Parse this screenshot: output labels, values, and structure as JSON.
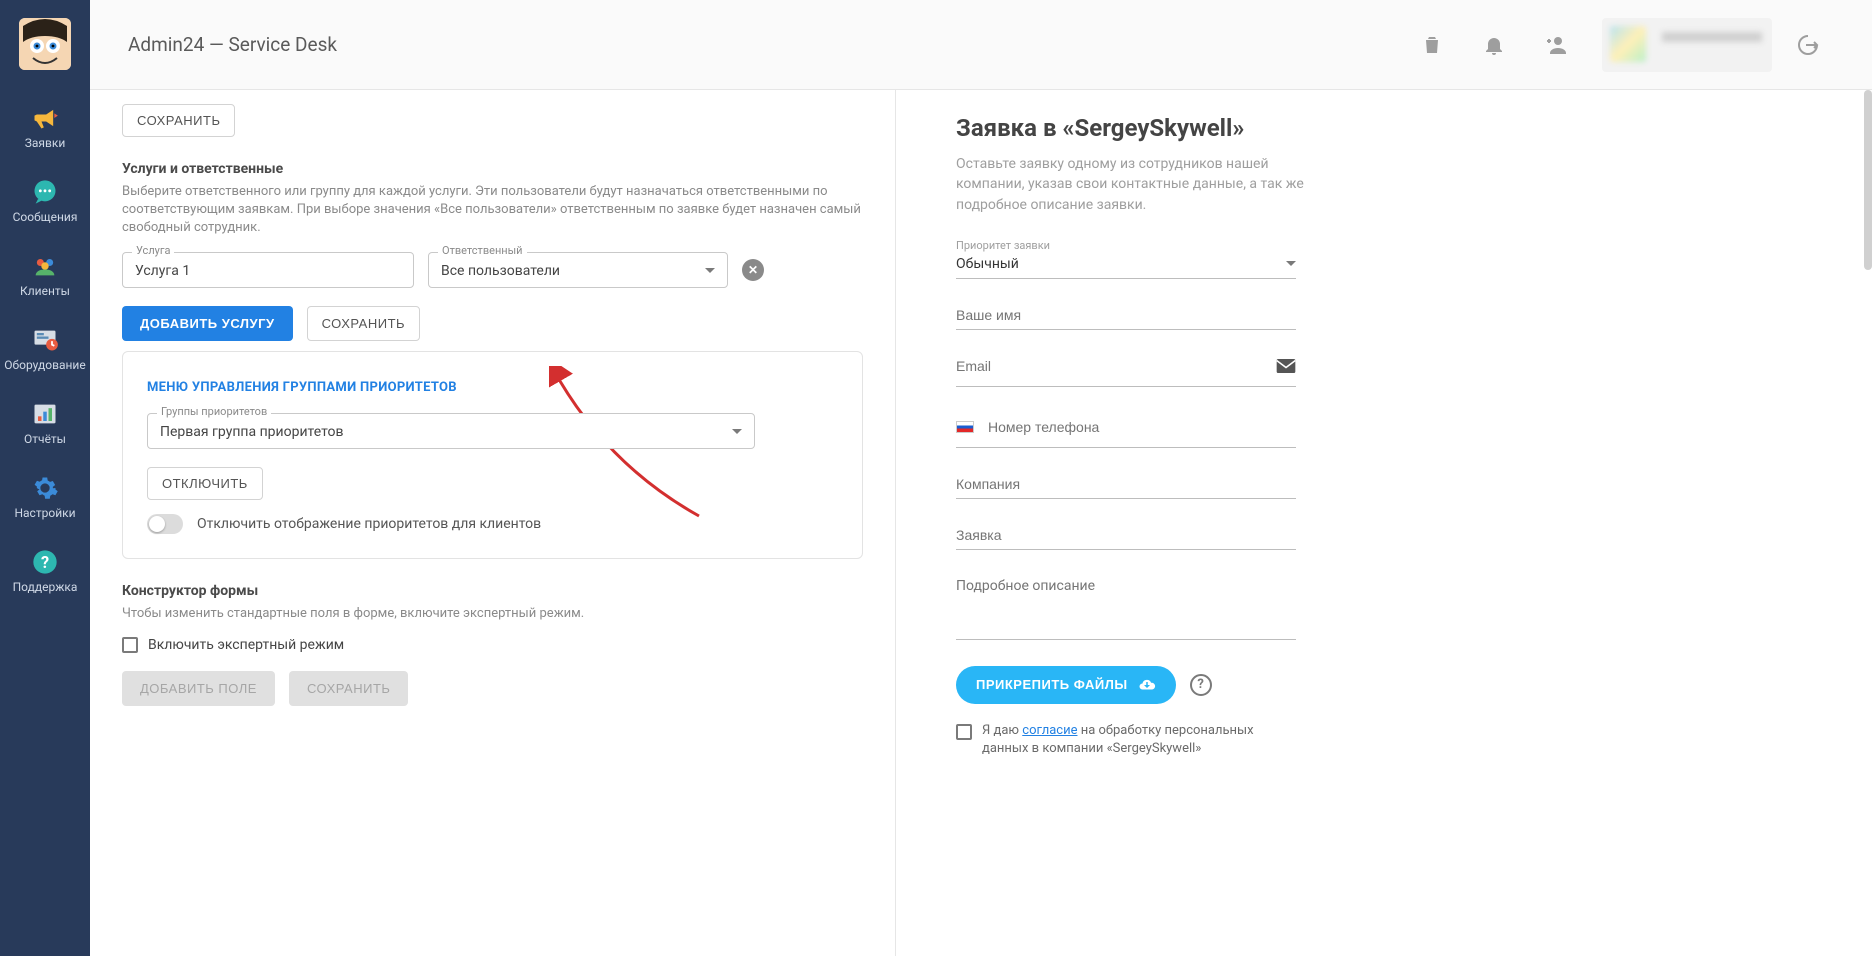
{
  "app_title": "Admin24 — Service Desk",
  "sidebar": [
    {
      "label": "Заявки",
      "icon": "megaphone"
    },
    {
      "label": "Сообщения",
      "icon": "chat"
    },
    {
      "label": "Клиенты",
      "icon": "people"
    },
    {
      "label": "Оборудование",
      "icon": "equipment"
    },
    {
      "label": "Отчёты",
      "icon": "reports"
    },
    {
      "label": "Настройки",
      "icon": "gear"
    },
    {
      "label": "Поддержка",
      "icon": "help"
    }
  ],
  "left": {
    "save_top": "СОХРАНИТЬ",
    "services_title": "Услуги и ответственные",
    "services_desc": "Выберите ответственного или группу для каждой услуги. Эти пользователи будут назначаться ответственными по соответствующим заявкам. При выборе значения «Все пользователи» ответственным по заявке будет назначен самый свободный сотрудник.",
    "service_label": "Услуга",
    "service_value": "Услуга 1",
    "responsible_label": "Ответственный",
    "responsible_value": "Все пользователи",
    "add_service": "ДОБАВИТЬ УСЛУГУ",
    "save2": "СОХРАНИТЬ",
    "priority_menu": "МЕНЮ УПРАВЛЕНИЯ ГРУППАМИ ПРИОРИТЕТОВ",
    "priority_group_label": "Группы приоритетов",
    "priority_group_value": "Первая группа приоритетов",
    "disable": "ОТКЛЮЧИТЬ",
    "toggle_text": "Отключить отображение приоритетов для клиентов",
    "builder_title": "Конструктор формы",
    "builder_desc": "Чтобы изменить стандартные поля в форме, включите экспертный режим.",
    "expert_checkbox": "Включить экспертный режим",
    "add_field": "ДОБАВИТЬ ПОЛЕ",
    "save3": "СОХРАНИТЬ"
  },
  "right": {
    "title": "Заявка в «SergeySkywell»",
    "subtitle": "Оставьте заявку одному из сотрудников нашей компании, указав свои контактные данные, а так же подробное описание заявки.",
    "priority_label": "Приоритет заявки",
    "priority_value": "Обычный",
    "name_ph": "Ваше имя",
    "email_ph": "Email",
    "phone_ph": "Номер телефона",
    "company_ph": "Компания",
    "request_ph": "Заявка",
    "details_ph": "Подробное описание",
    "attach": "ПРИКРЕПИТЬ ФАЙЛЫ",
    "consent_pre": "Я даю ",
    "consent_link": "согласие",
    "consent_post": " на обработку персональных данных в компании «SergeySkywell»"
  }
}
